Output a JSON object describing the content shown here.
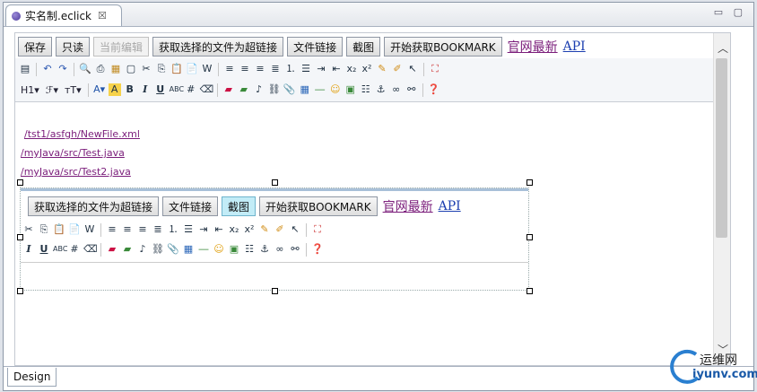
{
  "tab": {
    "title": "实名制.eclick",
    "close": "☒"
  },
  "window_controls": "▭ ▢",
  "main_buttons": [
    {
      "label": "保存",
      "disabled": false
    },
    {
      "label": "只读",
      "disabled": false
    },
    {
      "label": "当前编辑",
      "disabled": true
    },
    {
      "label": "获取选择的文件为超链接",
      "disabled": false
    },
    {
      "label": "文件链接",
      "disabled": false
    },
    {
      "label": "截图",
      "disabled": false
    },
    {
      "label": "开始获取BOOKMARK",
      "disabled": false
    }
  ],
  "links": {
    "latest": "官网最新",
    "api": "API"
  },
  "toolbar2": {
    "heading": "H1",
    "font": "ℱ",
    "size": "тT"
  },
  "content_links": [
    "/tst1/asfgh/NewFile.xml",
    "/myJava/src/Test.java",
    "/myJava/src/Test2.java"
  ],
  "embedded": {
    "buttons": [
      {
        "label": "获取选择的文件为超链接",
        "selected": false
      },
      {
        "label": "文件链接",
        "selected": false
      },
      {
        "label": "截图",
        "selected": true
      },
      {
        "label": "开始获取BOOKMARK",
        "selected": false
      }
    ],
    "links": {
      "latest": "官网最新",
      "api": "API"
    }
  },
  "bottom_tab": "Design",
  "watermark": {
    "line1": "运维网",
    "line2": "iyunv.com"
  },
  "colors": {
    "visited_link": "#7a1c7a",
    "link": "#1c3fb0",
    "selected_button": "#c2ecf7"
  }
}
